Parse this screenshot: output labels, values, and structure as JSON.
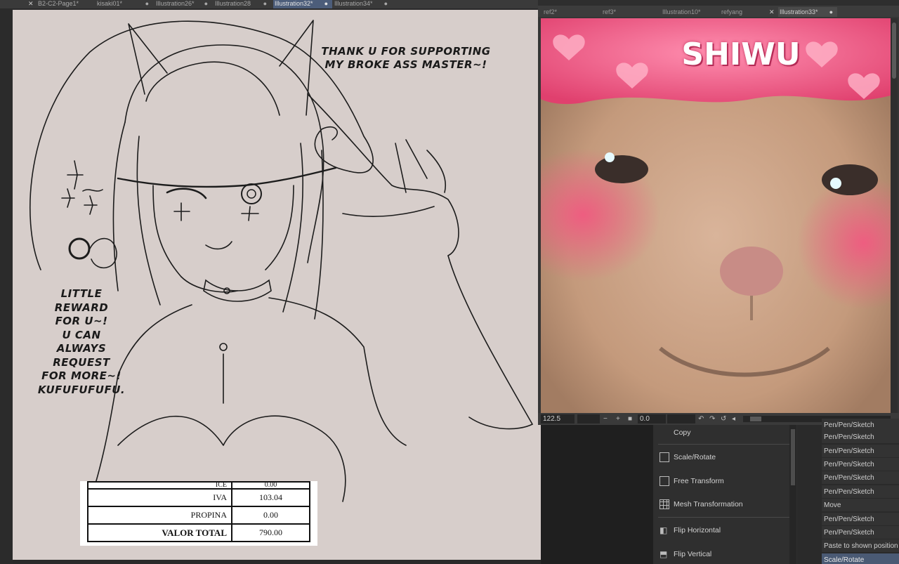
{
  "tabs": [
    {
      "label": "B2-C2-Page1*",
      "active": false
    },
    {
      "label": "kisaki01*",
      "active": false
    },
    {
      "label": "Illustration26*",
      "active": false
    },
    {
      "label": "Illustration28",
      "active": false
    },
    {
      "label": "Illustration32*",
      "active": true
    },
    {
      "label": "Illustration34*",
      "active": false
    }
  ],
  "canvas": {
    "speech_top": [
      "THANK U FOR SUPPORTING",
      "MY BROKE ASS MASTER~!"
    ],
    "speech_left": [
      "LITTLE REWARD",
      "FOR U~!",
      "U CAN",
      "ALWAYS",
      "REQUEST",
      "FOR MORE~!",
      "KUFUFUFUFU."
    ]
  },
  "receipt": {
    "rows": [
      {
        "label": "ICE",
        "value": "0.00"
      },
      {
        "label": "IVA",
        "value": "103.04"
      },
      {
        "label": "PROPINA",
        "value": "0.00"
      },
      {
        "label": "VALOR TOTAL",
        "value": "790.00"
      }
    ]
  },
  "reference": {
    "tabs": [
      {
        "label": "ref2*",
        "active": false
      },
      {
        "label": "ref3*",
        "active": false
      },
      {
        "label": "Illustration10*",
        "active": false
      },
      {
        "label": "refyang",
        "active": false
      },
      {
        "label": "Illustration33*",
        "active": true
      }
    ],
    "image_text": "SHIWU",
    "zoom": "122.5",
    "angle": "0.0"
  },
  "menu": {
    "items": [
      {
        "label": "Copy",
        "icon": "copy-icon"
      },
      {
        "label": "Scale/Rotate",
        "icon": "scale-rotate-icon"
      },
      {
        "label": "Free Transform",
        "icon": "free-transform-icon"
      },
      {
        "label": "Mesh Transformation",
        "icon": "mesh-transform-icon"
      },
      {
        "label": "Flip Horizontal",
        "icon": "flip-horizontal-icon"
      },
      {
        "label": "Flip Vertical",
        "icon": "flip-vertical-icon"
      }
    ]
  },
  "history": {
    "items": [
      {
        "label": "Pen/Pen/Sketch",
        "selected": false
      },
      {
        "label": "Pen/Pen/Sketch",
        "selected": false
      },
      {
        "label": "Pen/Pen/Sketch",
        "selected": false
      },
      {
        "label": "Pen/Pen/Sketch",
        "selected": false
      },
      {
        "label": "Pen/Pen/Sketch",
        "selected": false
      },
      {
        "label": "Pen/Pen/Sketch",
        "selected": false
      },
      {
        "label": "Move",
        "selected": false
      },
      {
        "label": "Pen/Pen/Sketch",
        "selected": false
      },
      {
        "label": "Pen/Pen/Sketch",
        "selected": false
      },
      {
        "label": "Paste to shown position",
        "selected": false
      },
      {
        "label": "Scale/Rotate",
        "selected": true
      }
    ]
  },
  "colors": {
    "canvas_bg": "#d7cecb",
    "active_tab": "#4c5d7a",
    "selected_history": "#4a5a74"
  }
}
